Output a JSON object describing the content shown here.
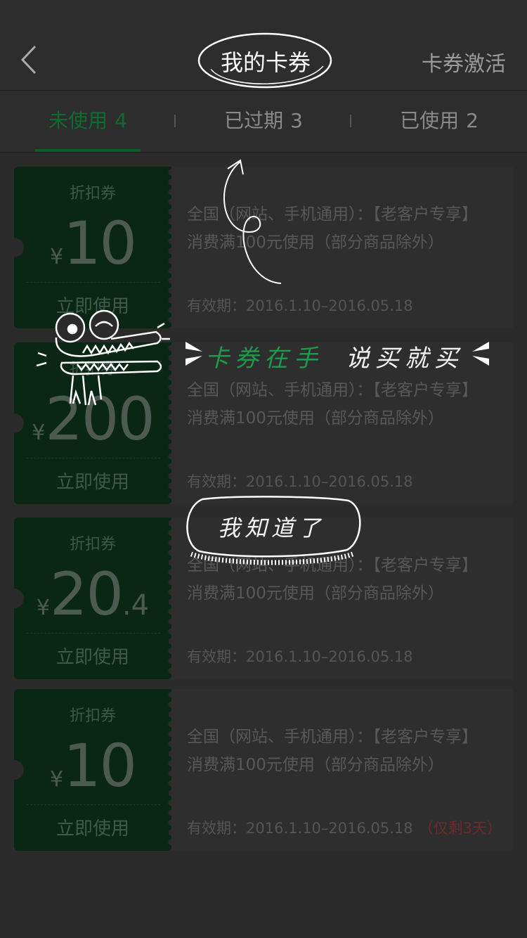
{
  "header": {
    "title": "我的卡券",
    "action": "卡券激活"
  },
  "tabs": [
    {
      "label": "未使用",
      "count": "4"
    },
    {
      "label": "已过期",
      "count": "3"
    },
    {
      "label": "已使用",
      "count": "2"
    }
  ],
  "coupons": [
    {
      "type": "折扣券",
      "currency": "¥",
      "amount": "10",
      "decimal": "",
      "use": "立即使用",
      "line1": "全国（网站、手机通用）：【老客户专享】",
      "line2": "消费满100元使用（部分商品除外）",
      "validity": "有效期：2016.1.10–2016.05.18",
      "remain": ""
    },
    {
      "type": "折扣券",
      "currency": "¥",
      "amount": "200",
      "decimal": "",
      "use": "立即使用",
      "line1": "全国（网站、手机通用）：【老客户专享】",
      "line2": "消费满100元使用（部分商品除外）",
      "validity": "有效期：2016.1.10–2016.05.18",
      "remain": ""
    },
    {
      "type": "折扣券",
      "currency": "¥",
      "amount": "20",
      "decimal": ".4",
      "use": "立即使用",
      "line1": "全国（网站、手机通用）：【老客户专享】",
      "line2": "消费满100元使用（部分商品除外）",
      "validity": "有效期：2016.1.10–2016.05.18",
      "remain": ""
    },
    {
      "type": "折扣券",
      "currency": "¥",
      "amount": "10",
      "decimal": "",
      "use": "立即使用",
      "line1": "全国（网站、手机通用）：【老客户专享】",
      "line2": "消费满100元使用（部分商品除外）",
      "validity": "有效期：2016.1.10–2016.05.18",
      "remain": "（仅剩3天）"
    }
  ],
  "guide": {
    "green": "卡券在手",
    "white": "说买就买",
    "button": "我知道了"
  },
  "colors": {
    "accent": "#0d5e28",
    "stub": "#0a2614",
    "background": "#2b2b2b",
    "guide_green": "#1f9a4c"
  }
}
